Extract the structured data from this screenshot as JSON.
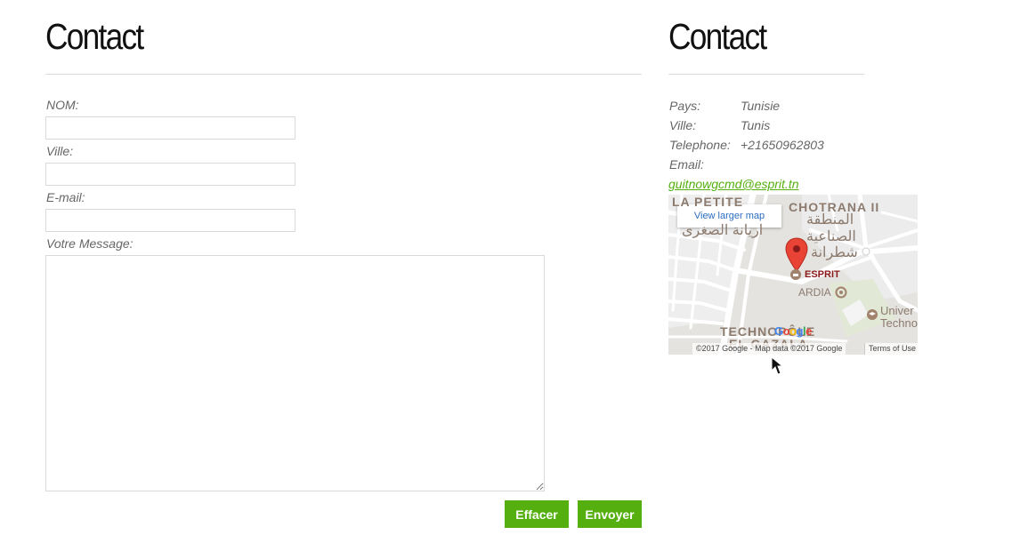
{
  "form_section": {
    "title": "Contact",
    "fields": {
      "nom": {
        "label": "NOM:",
        "value": ""
      },
      "ville": {
        "label": "Ville:",
        "value": ""
      },
      "email": {
        "label": "E-mail:",
        "value": ""
      },
      "message": {
        "label": "Votre Message:",
        "value": ""
      }
    },
    "buttons": {
      "reset": "Effacer",
      "submit": "Envoyer"
    }
  },
  "info_section": {
    "title": "Contact",
    "rows": [
      {
        "key": "Pays:",
        "value": "Tunisie"
      },
      {
        "key": "Ville:",
        "value": "Tunis"
      },
      {
        "key": "Telephone:",
        "value": "+21650962803"
      },
      {
        "key": "Email:",
        "value": ""
      }
    ],
    "email": "guitnowgcmd@esprit.tn"
  },
  "map": {
    "view_larger": "View larger map",
    "labels": {
      "petite": "LA PETITE",
      "chotrana": "CHOTRANA II",
      "arabic_left": "اريانة الصغرى",
      "arabic_right_1": "المنطقة",
      "arabic_right_2": "الصناعية",
      "arabic_right_3": "شطرانة",
      "techno": "TECHNOPÔLE",
      "gazala": "EL GAZALA",
      "esprit": "ESPRIT",
      "ardia": "ARDIA",
      "univer_1": "Univer",
      "univer_2": "Techno"
    },
    "google_logo": "Google",
    "attribution": "©2017 Google - Map data ©2017 Google",
    "terms": "Terms of Use"
  },
  "colors": {
    "accent": "#55b00f",
    "pin": "#e94335",
    "poi": "#8b1a1a"
  }
}
